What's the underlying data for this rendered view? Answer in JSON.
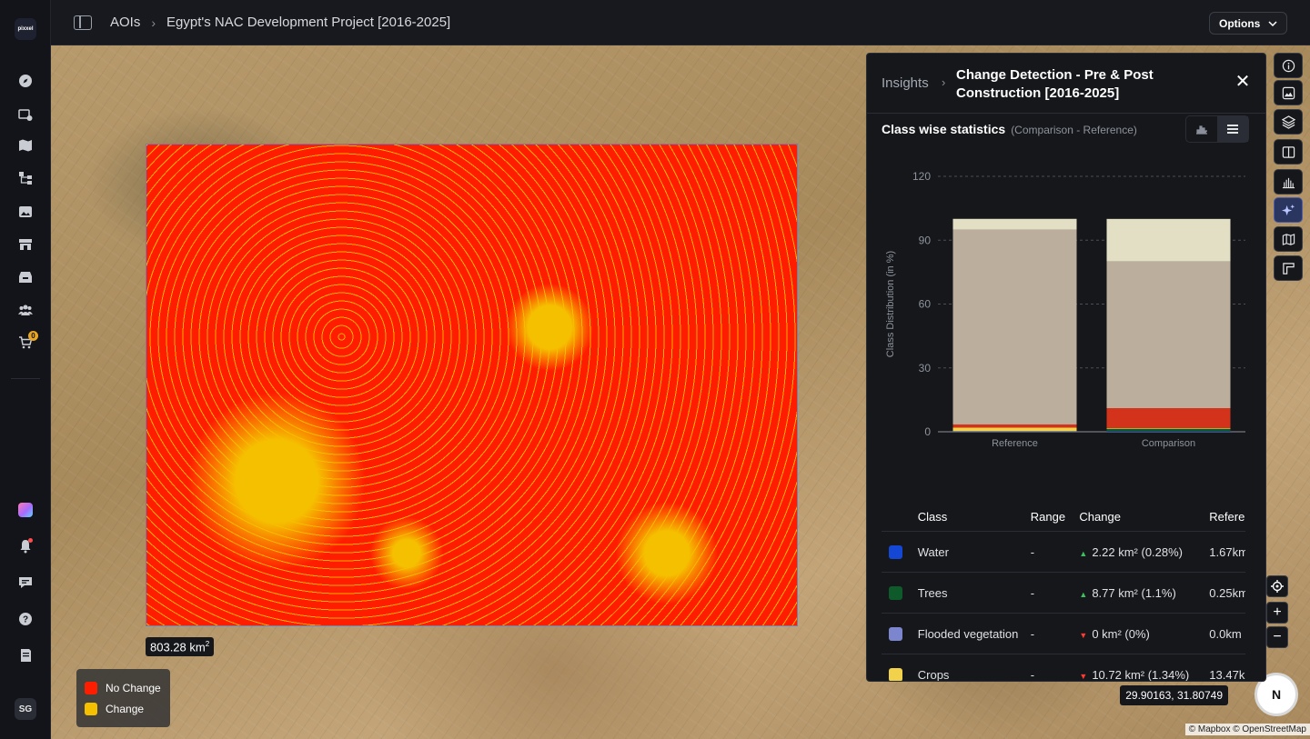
{
  "app": {
    "logo_text": "pixxel"
  },
  "rail": {
    "items": [
      {
        "icon": "compass-icon"
      },
      {
        "icon": "image-settings-icon"
      },
      {
        "icon": "map-icon"
      },
      {
        "icon": "workflow-icon"
      },
      {
        "icon": "gallery-icon"
      },
      {
        "icon": "store-icon"
      },
      {
        "icon": "archive-icon"
      },
      {
        "icon": "team-icon"
      },
      {
        "icon": "cart-icon",
        "badge": "0"
      }
    ],
    "bottom": [
      {
        "icon": "apps-gradient-icon"
      },
      {
        "icon": "bell-icon"
      },
      {
        "icon": "chat-icon"
      },
      {
        "icon": "help-icon"
      },
      {
        "icon": "docs-icon"
      }
    ],
    "avatar": "SG"
  },
  "topbar": {
    "breadcrumb_root": "AOIs",
    "breadcrumb_current": "Egypt's NAC Development Project [2016-2025]",
    "options_label": "Options"
  },
  "map": {
    "area_value": "803.28 km",
    "area_exp": "2",
    "legend": [
      {
        "label": "No Change",
        "color": "#ff1d00"
      },
      {
        "label": "Change",
        "color": "#f5c000"
      }
    ],
    "coords": "29.90163, 31.80749",
    "attribution": "© Mapbox © OpenStreetMap",
    "compass_label": "N",
    "zoom_in": "+",
    "zoom_out": "−"
  },
  "panel": {
    "crumb": "Insights",
    "title": "Change Detection - Pre & Post Construction [2016-2025]",
    "stats_title": "Class wise statistics",
    "stats_subtitle": "(Comparison - Reference)",
    "table": {
      "headers": [
        "Class",
        "Range",
        "Change",
        "Refere"
      ],
      "rows": [
        {
          "color": "#1447d4",
          "name": "Water",
          "range": "-",
          "dir": "up",
          "change": "2.22 km² (0.28%)",
          "ref": "1.67km"
        },
        {
          "color": "#0e5a2a",
          "name": "Trees",
          "range": "-",
          "dir": "up",
          "change": "8.77 km² (1.1%)",
          "ref": "0.25km"
        },
        {
          "color": "#7b86cf",
          "name": "Flooded vegetation",
          "range": "-",
          "dir": "down",
          "change": "0 km² (0%)",
          "ref": "0.0km"
        },
        {
          "color": "#f2d24a",
          "name": "Crops",
          "range": "-",
          "dir": "down",
          "change": "10.72 km² (1.34%)",
          "ref": "13.47k"
        }
      ]
    }
  },
  "chart_data": {
    "type": "bar",
    "stacked": true,
    "categories": [
      "Reference",
      "Comparison"
    ],
    "ylabel": "Class Distribution (in %)",
    "ylim": [
      0,
      120
    ],
    "yticks": [
      0,
      30,
      60,
      90,
      120
    ],
    "series": [
      {
        "values": [
          0.2,
          0.3
        ],
        "color": "#1447d4"
      },
      {
        "values": [
          0.03,
          1.1
        ],
        "color": "#0e5a2a"
      },
      {
        "values": [
          1.7,
          0.4
        ],
        "color": "#f2d24a"
      },
      {
        "values": [
          1.5,
          9.3
        ],
        "color": "#d4331b"
      },
      {
        "values": [
          91.6,
          68.9
        ],
        "color": "#bcae9c"
      },
      {
        "values": [
          5.0,
          20.0
        ],
        "color": "#e3dfc4"
      }
    ]
  }
}
